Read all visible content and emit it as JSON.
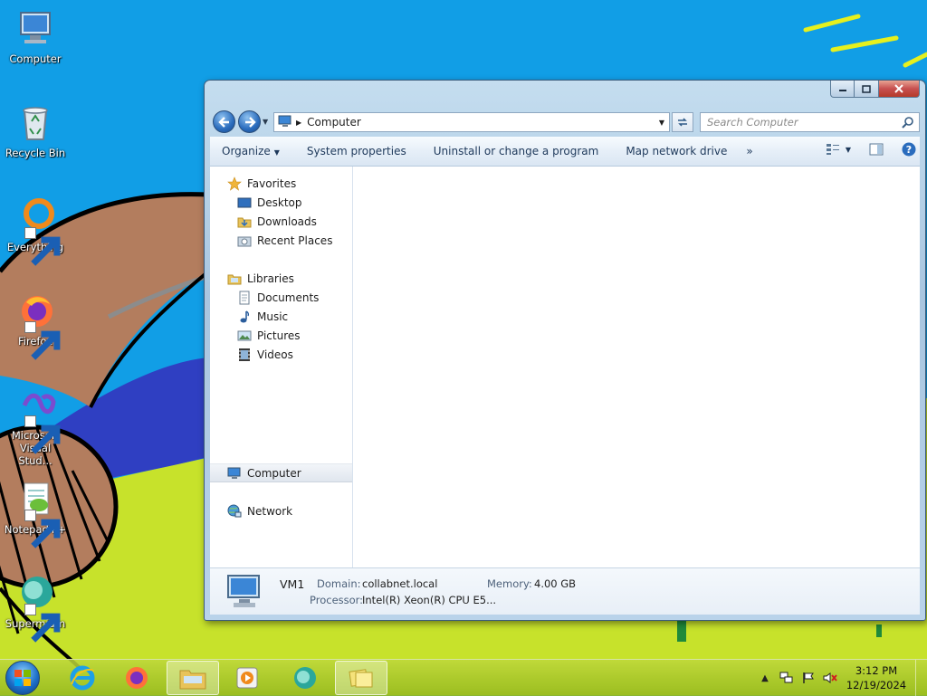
{
  "desktop": {
    "icons": [
      {
        "label": "Computer"
      },
      {
        "label": "Recycle Bin"
      },
      {
        "label": "Everything"
      },
      {
        "label": "Firefox"
      },
      {
        "label": "Microsoft Visual Stud..."
      },
      {
        "label": "Notepad++"
      },
      {
        "label": "Supermium"
      }
    ]
  },
  "window": {
    "address": "Computer",
    "search_placeholder": "Search Computer",
    "commands": {
      "organize": "Organize",
      "system_properties": "System properties",
      "uninstall": "Uninstall or change a program",
      "map_drive": "Map network drive",
      "more": "»"
    },
    "nav": {
      "favorites": "Favorites",
      "desktop": "Desktop",
      "downloads": "Downloads",
      "recent": "Recent Places",
      "libraries": "Libraries",
      "documents": "Documents",
      "music": "Music",
      "pictures": "Pictures",
      "videos": "Videos",
      "computer": "Computer",
      "network": "Network"
    },
    "details": {
      "name": "VM1",
      "domain_label": "Domain:",
      "domain_value": "collabnet.local",
      "memory_label": "Memory:",
      "memory_value": "4.00 GB",
      "processor_label": "Processor:",
      "processor_value": "Intel(R) Xeon(R) CPU E5..."
    }
  },
  "taskbar": {
    "clock_time": "3:12 PM",
    "clock_date": "12/19/2024"
  },
  "colors": {
    "sky": "#119ee6",
    "grass": "#c7e22b",
    "window_frame": "#b9d3ea",
    "accent": "#1e395b"
  }
}
